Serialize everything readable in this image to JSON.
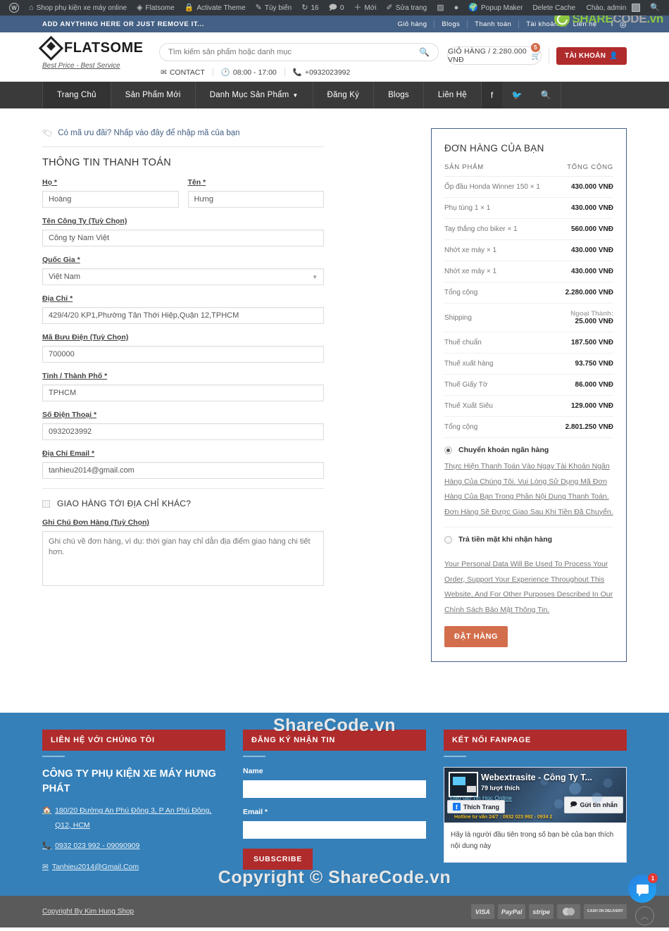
{
  "adminbar": {
    "items": [
      {
        "icon": "wordpress-logo-icon",
        "label": ""
      },
      {
        "icon": "home-icon",
        "label": "Shop phụ kiện xe máy online"
      },
      {
        "icon": "flatsome-icon",
        "label": "Flatsome"
      },
      {
        "icon": "lock-icon",
        "label": "Activate Theme"
      },
      {
        "icon": "pencil-icon",
        "label": "Tùy biến"
      },
      {
        "icon": "update-icon",
        "label": "16"
      },
      {
        "icon": "comment-icon",
        "label": "0"
      },
      {
        "icon": "plus-icon",
        "label": "Mới"
      },
      {
        "icon": "edit-icon",
        "label": "Sửa trang"
      },
      {
        "icon": "plugin-icon",
        "label": ""
      },
      {
        "icon": "dot-icon",
        "label": ""
      },
      {
        "icon": "popup-maker-icon",
        "label": "Popup Maker"
      },
      {
        "icon": "",
        "label": "Delete Cache"
      }
    ],
    "greeting": "Chào, admin",
    "search_icon": "search-icon"
  },
  "topbar": {
    "promo": "ADD ANYTHING HERE OR JUST REMOVE IT...",
    "links": [
      "Giỏ hàng",
      "Blogs",
      "Thanh toán",
      "Tài khoản",
      "Liên hệ"
    ],
    "social": [
      "facebook-icon",
      "instagram-icon"
    ],
    "bg": "#446084"
  },
  "watermark": {
    "brand_share": "SHARE",
    "brand_code": "CODE",
    "brand_vn": ".vn",
    "center_top": "ShareCode.vn",
    "center_bottom": "Copyright © ShareCode.vn"
  },
  "header": {
    "logo_text": "FLATSOME",
    "logo_sup": "®",
    "tagline": "Best Price - Best Service",
    "search_placeholder": "Tìm kiếm sản phẩm hoặc danh mục",
    "meta": [
      {
        "icon": "mail-icon",
        "label": "CONTACT"
      },
      {
        "icon": "clock-icon",
        "label": "08:00 - 17:00"
      },
      {
        "icon": "phone-icon",
        "label": "+0932023992"
      }
    ],
    "cart_label": "GIỎ HÀNG / 2.280.000 VNĐ",
    "cart_count": "5",
    "account_label": "TÀI KHOẢN"
  },
  "nav": {
    "items": [
      "Trang Chủ",
      "Sản Phẩm Mới",
      "Danh Mục Sản Phẩm",
      "Đăng Ký",
      "Blogs",
      "Liên Hệ"
    ],
    "dropdown_on": "Danh Mục Sản Phẩm",
    "icons": [
      "facebook-icon",
      "twitter-icon",
      "search-icon"
    ]
  },
  "checkout": {
    "coupon_text": "Có mã ưu đãi? Nhấp vào đây để nhập mã của bạn",
    "section_title": "THÔNG TIN THANH TOÁN",
    "fields": [
      {
        "label": "Họ",
        "req": "*",
        "value": "Hoàng"
      },
      {
        "label": "Tên",
        "req": "*",
        "value": "Hưng"
      },
      {
        "label": "Tên Công Ty (Tuỳ Chọn)",
        "req": "",
        "value": "Công ty Nam Việt"
      },
      {
        "label": "Quốc Gia",
        "req": "*",
        "value": "Việt Nam"
      },
      {
        "label": "Địa Chỉ",
        "req": "*",
        "value": "429/4/20 KP1,Phường Tân Thới Hiệp,Quận 12,TPHCM"
      },
      {
        "label": "Mã Bưu Điện (Tuỳ Chọn)",
        "req": "",
        "value": "700000"
      },
      {
        "label": "Tỉnh / Thành Phố",
        "req": "*",
        "value": "TPHCM"
      },
      {
        "label": "Số Điện Thoại",
        "req": "*",
        "value": "0932023992"
      },
      {
        "label": "Địa Chỉ Email",
        "req": "*",
        "value": "tanhieu2014@gmail.com"
      }
    ],
    "ship_different_label": "GIAO HÀNG TỚI ĐỊA CHỈ KHÁC?",
    "notes_label": "Ghi Chú Đơn Hàng (Tuỳ Chọn)",
    "notes_placeholder": "Ghi chú về đơn hàng, ví dụ: thời gian hay chỉ dẫn địa điểm giao hàng chi tiết hơn."
  },
  "order": {
    "title": "ĐƠN HÀNG CỦA BẠN",
    "col_product": "SẢN PHẨM",
    "col_total": "TỔNG CỘNG",
    "lines": [
      {
        "name": "Ốp đầu Honda Winner 150  × 1",
        "amount": "430.000 VNĐ"
      },
      {
        "name": "Phụ tùng 1 × 1",
        "amount": "430.000 VNĐ"
      },
      {
        "name": "Tay thắng cho biker  × 1",
        "amount": "560.000 VNĐ"
      },
      {
        "name": "Nhớt xe máy  × 1",
        "amount": "430.000 VNĐ"
      },
      {
        "name": "Nhớt xe máy  × 1",
        "amount": "430.000 VNĐ"
      }
    ],
    "totals": [
      {
        "label": "Tổng cộng",
        "note": "",
        "amount": "2.280.000 VNĐ"
      },
      {
        "label": "Shipping",
        "note": "Ngoại Thành:",
        "amount": "25.000 VNĐ"
      },
      {
        "label": "Thuế chuẩn",
        "note": "",
        "amount": "187.500 VNĐ"
      },
      {
        "label": "Thuế xuất hàng",
        "note": "",
        "amount": "93.750 VNĐ"
      },
      {
        "label": "Thuế Giấy Tờ",
        "note": "",
        "amount": "86.000 VNĐ"
      },
      {
        "label": "Thuế Xuất Siêu",
        "note": "",
        "amount": "129.000 VNĐ"
      },
      {
        "label": "Tổng cộng",
        "note": "",
        "amount": "2.801.250 VNĐ"
      }
    ],
    "payment_bank_label": "Chuyển khoản ngân hàng",
    "payment_bank_desc": "Thực Hiện Thanh Toán Vào Ngay Tài Khoản Ngân Hàng Của Chúng Tôi. Vui Lòng Sử Dụng Mã Đơn Hàng Của Bạn Trong Phần Nội Dung Thanh Toán. Đơn Hàng Sẽ Được Giao Sau Khi Tiền Đã Chuyển.",
    "payment_cod_label": "Trả tiền mặt khi nhận hàng",
    "privacy": "Your Personal Data Will Be Used To Process Your Order, Support Your Experience Throughout This Website, And For Other Purposes Described In Our Chính Sách Bảo Mật Thông Tin.",
    "submit_label": "ĐẶT HÀNG",
    "accent": "#d26e4b"
  },
  "footer": {
    "col1": {
      "heading": "LIÊN HỆ VỚI CHÚNG TÔI",
      "company": "CÔNG TY PHỤ KIỆN XE MÁY HƯNG PHÁT",
      "address": "180/20 Đường An Phú Đông 3, P An Phú Đông, Q12, HCM",
      "phone": "0932 023 992 - 09090909",
      "email": "Tanhieu2014@Gmail.Com"
    },
    "col2": {
      "heading": "ĐĂNG KÝ NHẬN TIN",
      "name_label": "Name",
      "email_label": "Email *",
      "subscribe_label": "SUBSCRIBE"
    },
    "col3": {
      "heading": "KẾT NỐI FANPAGE",
      "fb_page_name": "Webextrasite - Công Ty T...",
      "fb_likes": "79 lượt thích",
      "fb_sub": "Đào tạo Tin Học Online",
      "fb_hotline": "Hotline tư vấn 24/7 : 0932 023 992 - 0934 2",
      "fb_like_btn": "Thích Trang",
      "fb_msg_btn": "Gửi tin nhắn",
      "fb_body": "Hãy là người đầu tiên trong số bạn bè của bạn thích nội dung này"
    },
    "copyright": "Copyright By Kim Hung Shop",
    "payments": [
      "VISA",
      "PayPal",
      "stripe",
      "MasterCard",
      "CASH ON DELIVERY"
    ],
    "bg": "#3580b9"
  },
  "widgets": {
    "chat_badge": "1",
    "to_top_icon": "chevron-up-icon"
  }
}
